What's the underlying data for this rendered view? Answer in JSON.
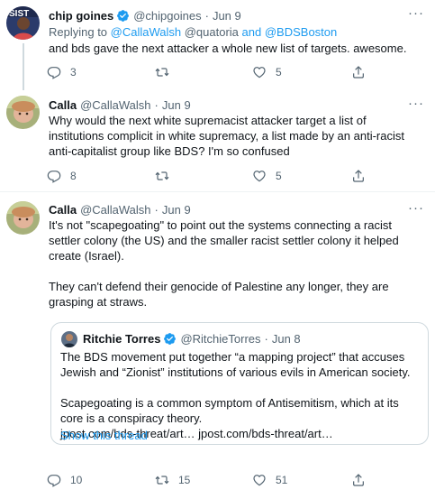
{
  "tweets": [
    {
      "name": "chip goines",
      "handle": "@chipgoines",
      "dot": "·",
      "time": "Jun 9",
      "replying_prefix": "Replying to ",
      "replying_to_1": "@CallaWalsh",
      "replying_to_2": " @quatoria ",
      "replying_and": "and ",
      "replying_to_3": "@BDSBoston",
      "text": "and bds gave the next attacker a whole new list of targets. awesome.",
      "replies": "3",
      "retweets": "",
      "likes": "5",
      "verified": true
    },
    {
      "name": "Calla",
      "handle": "@CallaWalsh",
      "dot": "·",
      "time": "Jun 9",
      "text": "Why would the next white supremacist attacker target a list of institutions complicit in white supremacy, a list made by an anti-racist anti-capitalist group like BDS? I'm so confused",
      "replies": "8",
      "retweets": "",
      "likes": "5"
    },
    {
      "name": "Calla",
      "handle": "@CallaWalsh",
      "dot": "·",
      "time": "Jun 9",
      "text_p1": "It's not \"scapegoating\" to point out the systems connecting a racist settler colony (the US) and the smaller racist settler colony it helped create (Israel).",
      "text_p2": "They can't defend their genocide of Palestine any longer, they are grasping at straws.",
      "replies": "10",
      "retweets": "15",
      "likes": "51",
      "quote": {
        "name": "Ritchie Torres",
        "handle": "@RitchieTorres",
        "dot": "·",
        "time": "Jun 8",
        "text_p1": "The BDS movement put together “a mapping project” that accuses Jewish and “Zionist” institutions of various evils in American society.",
        "text_p2": "Scapegoating is a common symptom of Antisemitism, which at its core is a conspiracy theory.",
        "text_links": "jpost.com/bds-threat/art… jpost.com/bds-threat/art…",
        "show_thread": "Show this thread",
        "verified": true
      }
    }
  ],
  "more_label": "···",
  "icons": [
    "reply-icon",
    "retweet-icon",
    "like-icon",
    "share-icon",
    "verified-badge-icon",
    "more-icon"
  ],
  "colors": {
    "link": "#1d9bf0",
    "secondary": "#536471",
    "border": "#cfd9de",
    "text": "#0f1419"
  }
}
